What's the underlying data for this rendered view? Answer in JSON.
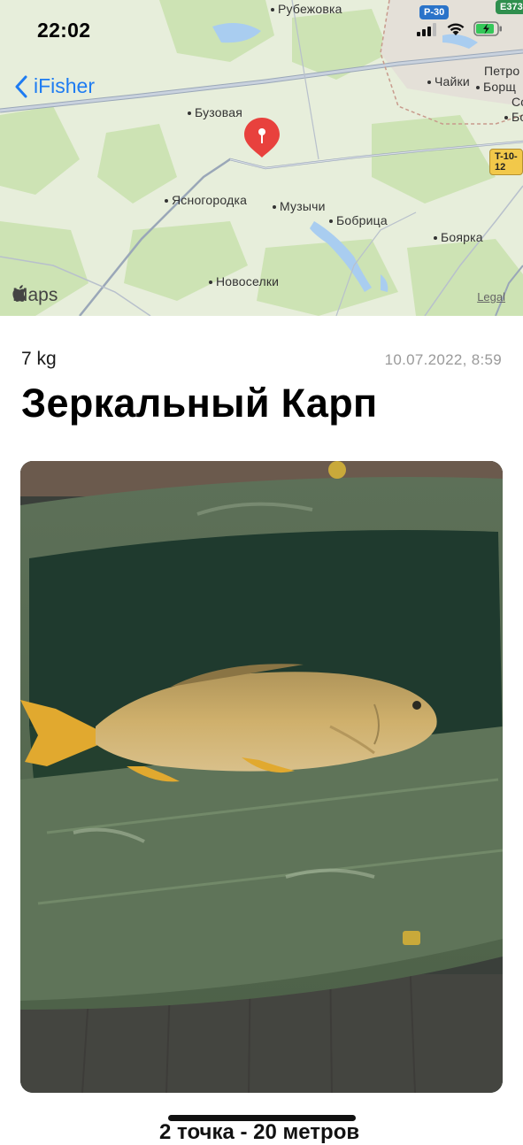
{
  "status_bar": {
    "time": "22:02"
  },
  "nav": {
    "back_label": "iFisher"
  },
  "map": {
    "places": [
      "Рубежовка",
      "Бузовая",
      "Ясногородка",
      "Музычи",
      "Бобрица",
      "Новоселки",
      "Чайки",
      "Петро",
      "Борщ",
      "Бо",
      "Боярка",
      "Со"
    ],
    "road_badges": [
      "P-30",
      "E373",
      "T-10-12"
    ],
    "maps_label": "Maps",
    "legal_label": "Legal"
  },
  "catch": {
    "weight": "7 kg",
    "datetime": "10.07.2022, 8:59",
    "title": "Зеркальный Карп"
  },
  "footer": {
    "partial_text": "2 точка - 20 метров"
  },
  "colors": {
    "accent": "#1e7cf2",
    "pin": "#e8413d"
  }
}
